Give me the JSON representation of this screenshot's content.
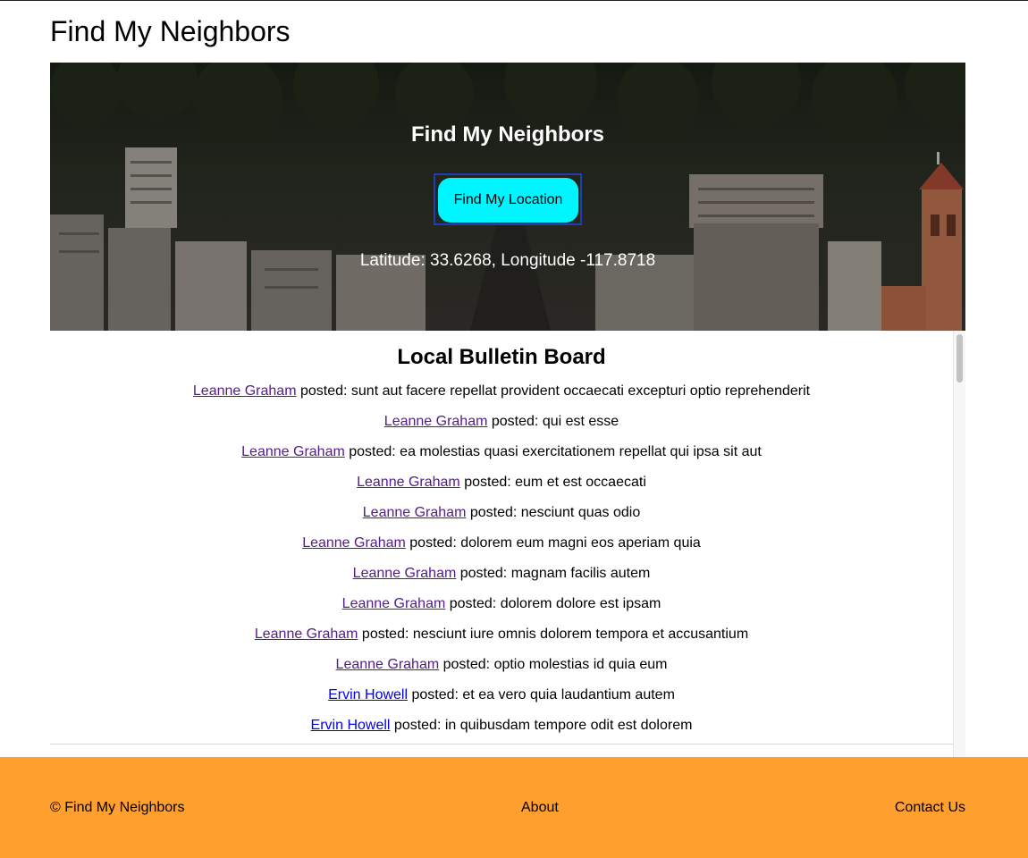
{
  "site": {
    "title": "Find My Neighbors"
  },
  "hero": {
    "title": "Find My Neighbors",
    "locate_button": "Find My Location",
    "coordinates": "Latitude: 33.6268, Longitude -117.8718"
  },
  "board": {
    "title": "Local Bulletin Board",
    "posts": [
      {
        "author": "Leanne Graham",
        "verb": " posted: ",
        "text": "sunt aut facere repellat provident occaecati excepturi optio reprehenderit"
      },
      {
        "author": "Leanne Graham",
        "verb": " posted: ",
        "text": "qui est esse"
      },
      {
        "author": "Leanne Graham",
        "verb": " posted: ",
        "text": "ea molestias quasi exercitationem repellat qui ipsa sit aut"
      },
      {
        "author": "Leanne Graham",
        "verb": " posted: ",
        "text": "eum et est occaecati"
      },
      {
        "author": "Leanne Graham",
        "verb": " posted: ",
        "text": "nesciunt quas odio"
      },
      {
        "author": "Leanne Graham",
        "verb": " posted: ",
        "text": "dolorem eum magni eos aperiam quia"
      },
      {
        "author": "Leanne Graham",
        "verb": " posted: ",
        "text": "magnam facilis autem"
      },
      {
        "author": "Leanne Graham",
        "verb": " posted: ",
        "text": "dolorem dolore est ipsam"
      },
      {
        "author": "Leanne Graham",
        "verb": " posted: ",
        "text": "nesciunt iure omnis dolorem tempora et accusantium"
      },
      {
        "author": "Leanne Graham",
        "verb": " posted: ",
        "text": "optio molestias id quia eum"
      },
      {
        "author": "Ervin Howell",
        "verb": " posted: ",
        "text": "et ea vero quia laudantium autem"
      },
      {
        "author": "Ervin Howell",
        "verb": " posted: ",
        "text": "in quibusdam tempore odit est dolorem"
      }
    ]
  },
  "footer": {
    "copyright": "© Find My Neighbors",
    "about": "About",
    "contact": "Contact Us"
  },
  "colors": {
    "locate_button": "#00f6ff",
    "footer_bg": "#ff9f2e",
    "link_visited": "#551a8b",
    "link_unvisited": "#0000ee"
  }
}
